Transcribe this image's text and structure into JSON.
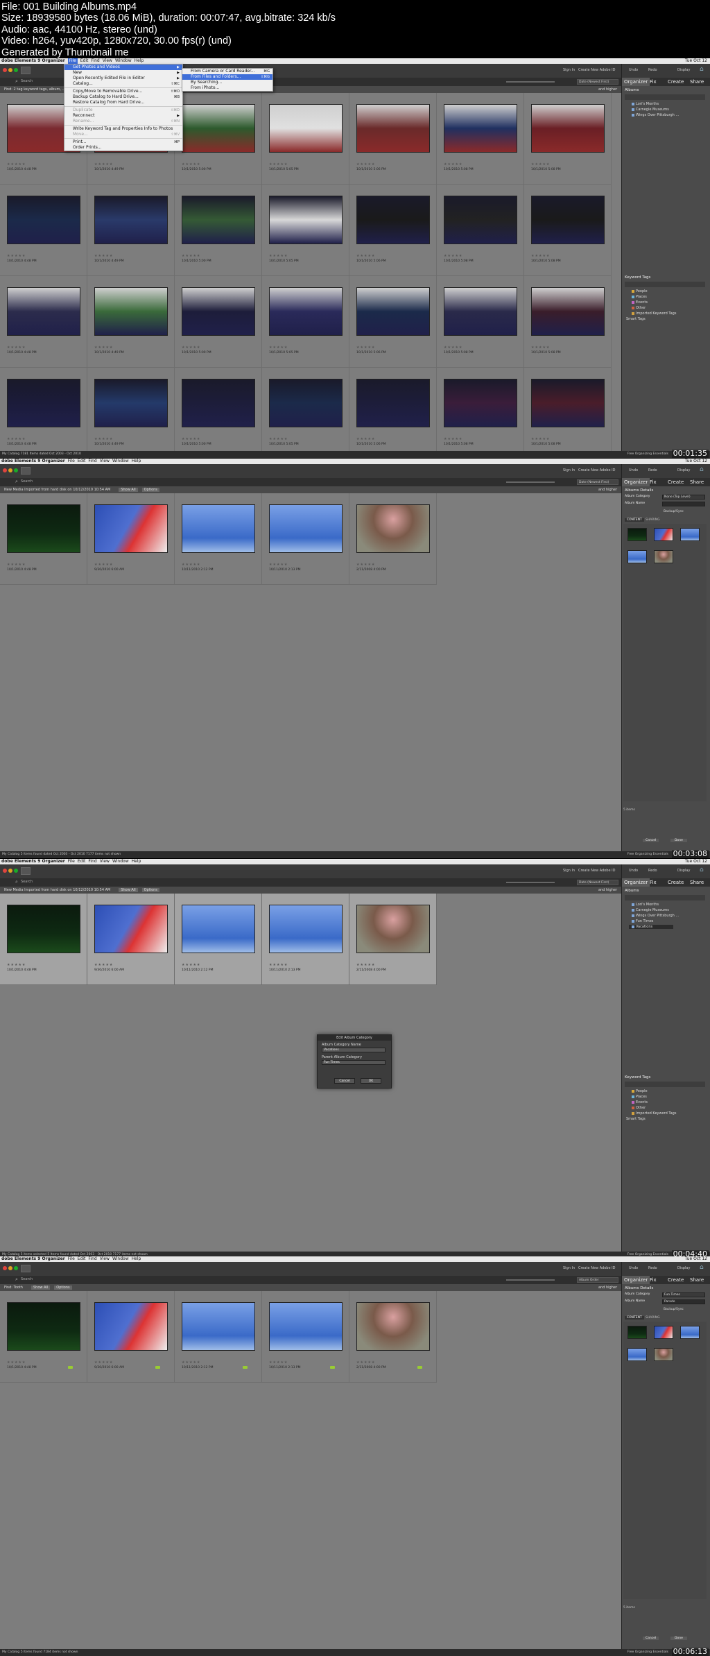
{
  "file_info": [
    "File: 001 Building Albums.mp4",
    "Size: 18939580 bytes (18.06 MiB), duration: 00:07:47, avg.bitrate: 324 kb/s",
    "Audio: aac, 44100 Hz, stereo (und)",
    "Video: h264, yuv420p, 1280x720, 30.00 fps(r) (und)",
    "Generated by Thumbnail me"
  ],
  "app": {
    "title": "dobe Elements 9 Organizer",
    "menus": [
      "File",
      "Edit",
      "Find",
      "View",
      "Window",
      "Help"
    ],
    "clock": "Tue Oct 12",
    "tabs": [
      "Organizer",
      "Fix",
      "Create",
      "Share"
    ],
    "sign_in": "Sign In",
    "create_id": "Create New Adobe ID",
    "search_label": "Search",
    "panel_tools": [
      "Undo",
      "Redo",
      "Display"
    ]
  },
  "frames": [
    {
      "timestamp": "00:01:35",
      "filter_text": "Find: 2 tag keyword tags, album, ...",
      "filter_right": "and higher",
      "sort_label": "Date (Newest First)",
      "status_left": "My Catalog   7181 Items dated Oct 2003 - Oct 2010",
      "status_right": "Free Organizing Essentials",
      "dates": [
        "10/1/2010 4:48 PM",
        "10/1/2010 4:49 PM",
        "10/1/2010 5:00 PM",
        "10/1/2010 5:05 PM",
        "10/1/2010 5:06 PM",
        "10/1/2010 5:08 PM",
        "10/1/2010 5:08 PM"
      ],
      "albums_title": "Albums",
      "albums": [
        "Lori's Months",
        "Carnegie Museums",
        "Wings Over Pittsburgh ..."
      ],
      "keyword_title": "Keyword Tags",
      "keyword_tags": [
        "People",
        "Places",
        "Events",
        "Other",
        "Imported Keyword Tags",
        "Smart Tags"
      ],
      "file_menu": {
        "items": [
          {
            "label": "Get Photos and Videos",
            "shortcut": "▶",
            "state": "highlight"
          },
          {
            "label": "New",
            "shortcut": "▶",
            "state": "normal"
          },
          {
            "label": "Open Recently Edited File in Editor",
            "shortcut": "▶",
            "state": "normal"
          },
          {
            "label": "Catalog...",
            "shortcut": "⇧⌘C",
            "state": "normal"
          },
          {
            "label": "Copy/Move to Removable Drive...",
            "shortcut": "⇧⌘O",
            "state": "normal"
          },
          {
            "label": "Backup Catalog to Hard Drive...",
            "shortcut": "⌘B",
            "state": "normal"
          },
          {
            "label": "Restore Catalog from Hard Drive...",
            "shortcut": "",
            "state": "normal"
          },
          {
            "label": "Duplicate",
            "shortcut": "⇧⌘D",
            "state": "disabled"
          },
          {
            "label": "Reconnect",
            "shortcut": "▶",
            "state": "normal"
          },
          {
            "label": "Rename...",
            "shortcut": "⇧⌘N",
            "state": "disabled"
          },
          {
            "label": "Write Keyword Tag and Properties Info to Photos",
            "shortcut": "",
            "state": "normal"
          },
          {
            "label": "Move...",
            "shortcut": "⇧⌘V",
            "state": "disabled"
          },
          {
            "label": "Print...",
            "shortcut": "⌘P",
            "state": "normal"
          },
          {
            "label": "Order Prints...",
            "shortcut": "",
            "state": "normal"
          }
        ],
        "submenu": [
          {
            "label": "From Camera or Card Reader...",
            "shortcut": "⌘G",
            "state": "normal"
          },
          {
            "label": "From Files and Folders...",
            "shortcut": "⇧⌘G",
            "state": "highlight"
          },
          {
            "label": "By Searching...",
            "shortcut": "",
            "state": "normal"
          },
          {
            "label": "From iPhoto...",
            "shortcut": "",
            "state": "normal"
          }
        ]
      }
    },
    {
      "timestamp": "00:03:08",
      "filter_text": "New Media  Imported from hard disk on 10/12/2010 10:54 AM",
      "show_all": "Show All",
      "options": "Options",
      "filter_right": "and higher",
      "sort_label": "Date (Newest First)",
      "status_left": "My Catalog   5 Items found dated Oct 2003 - Oct 2010   7177 items not shown",
      "status_right": "Free Organizing Essentials",
      "dates": [
        "10/1/2010 4:48 PM",
        "9/30/2010 6:00 AM",
        "10/11/2010 2:12 PM",
        "10/11/2010 2:13 PM",
        "2/11/2008 4:00 PM"
      ],
      "details": {
        "title": "Albums Details",
        "category_label": "Album Category",
        "category_value": "None (Top Level)",
        "name_label": "Album Name",
        "backup": "Backup/Sync",
        "content_tab": "CONTENT",
        "sharing_tab": "SHARING",
        "count": "5 items",
        "cancel": "Cancel",
        "done": "Done"
      }
    },
    {
      "timestamp": "00:04:40",
      "filter_text": "New Media  Imported from hard disk on 10/12/2010 10:54 AM",
      "show_all": "Show All",
      "options": "Options",
      "filter_right": "and higher",
      "sort_label": "Date (Newest First)",
      "status_left": "My Catalog   5 items selected   5 Items found dated Oct 2003 - Oct 2010   7177 items not shown",
      "status_right": "Free Organizing Essentials",
      "dates": [
        "10/1/2010 4:48 PM",
        "9/30/2010 6:00 AM",
        "10/11/2010 2:12 PM",
        "10/11/2010 2:13 PM",
        "2/11/2008 4:00 PM"
      ],
      "albums_title": "Albums",
      "albums": [
        "Lori's Months",
        "Carnegie Museums",
        "Wings Over Pittsburgh ...",
        "Fun Times",
        "Vacations"
      ],
      "keyword_title": "Keyword Tags",
      "keyword_tags": [
        "People",
        "Places",
        "Events",
        "Other",
        "Imported Keyword Tags",
        "Smart Tags"
      ],
      "dialog": {
        "title": "Edit Album Category",
        "name_label": "Album Category Name",
        "name_value": "Vacations",
        "parent_label": "Parent Album Category",
        "parent_value": "Fun Times",
        "cancel": "Cancel",
        "ok": "OK"
      }
    },
    {
      "timestamp": "00:06:13",
      "filter_text": "Find:  Tooth",
      "show_all": "Show All",
      "options": "Options",
      "filter_right": "and higher",
      "sort_label": "Album Order",
      "status_left": "My Catalog   5 Items found   7184 items not shown",
      "status_right": "Free Organizing Essentials",
      "dates": [
        "10/1/2010 4:48 PM",
        "9/30/2010 6:00 AM",
        "10/11/2010 2:12 PM",
        "10/11/2010 2:13 PM",
        "2/11/2008 4:00 PM"
      ],
      "details": {
        "title": "Albums Details",
        "category_label": "Album Category",
        "category_value": "Fun Times",
        "name_label": "Album Name",
        "name_value": "Parade",
        "backup": "Backup/Sync",
        "content_tab": "CONTENT",
        "sharing_tab": "SHARING",
        "count": "5 items",
        "cancel": "Cancel",
        "done": "Done"
      }
    }
  ],
  "colors": {
    "grid_bg": "#7d7d7d",
    "toolbar_bg": "#3a3a3a",
    "panel_bg": "#4b4b4b",
    "menu_highlight": "#3f6fd9",
    "tag_green": "#99cc33"
  }
}
